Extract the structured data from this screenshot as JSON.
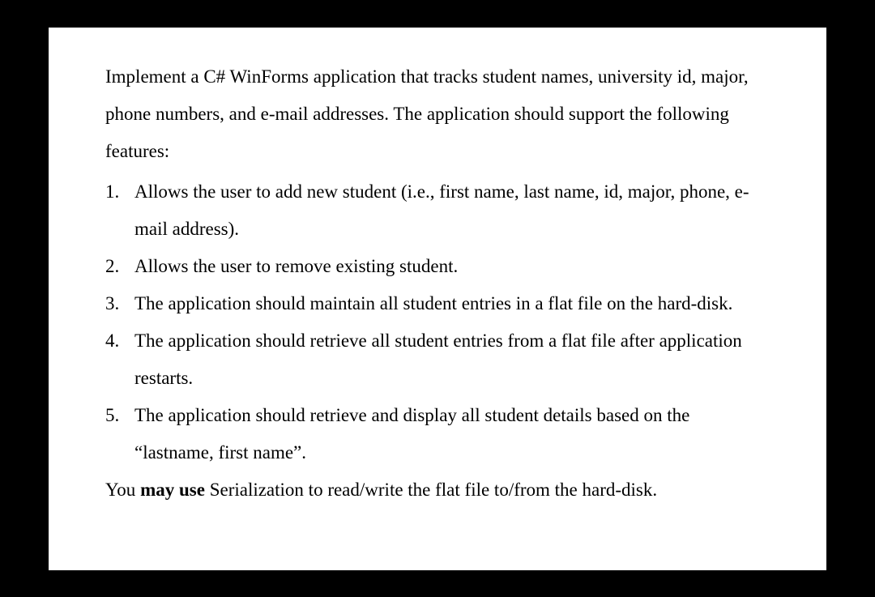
{
  "intro": "Implement a C# WinForms application that tracks student names, university id, major, phone numbers, and e-mail addresses. The application should support the following features:",
  "items": [
    "Allows the user to add new student (i.e., first name, last name, id, major, phone, e-mail address).",
    "Allows the user to remove existing student.",
    "The application should maintain all student entries in a flat file on the hard-disk.",
    "The application should retrieve all student entries from a flat file after application restarts.",
    "The application should retrieve and display all student details based on the “lastname, first name”."
  ],
  "closing_prefix": "You ",
  "closing_bold": "may use",
  "closing_suffix": " Serialization to read/write the flat file to/from the hard-disk."
}
